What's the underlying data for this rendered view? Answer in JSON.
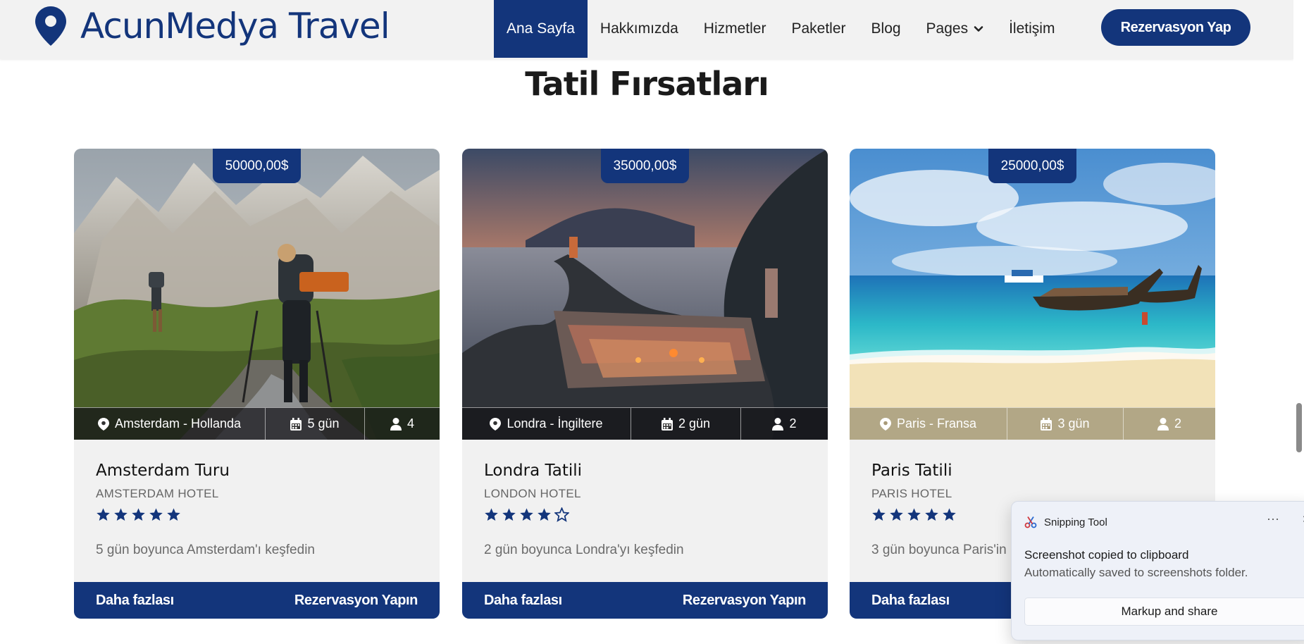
{
  "header": {
    "brand": "AcunMedya Travel",
    "nav": [
      {
        "label": "Ana Sayfa",
        "active": true
      },
      {
        "label": "Hakkımızda"
      },
      {
        "label": "Hizmetler"
      },
      {
        "label": "Paketler"
      },
      {
        "label": "Blog"
      },
      {
        "label": "Pages",
        "dropdown": true
      },
      {
        "label": "İletişim"
      }
    ],
    "cta": "Rezervasyon Yap",
    "accent_color": "#13357b"
  },
  "section": {
    "title": "Tatil Fırsatları"
  },
  "cards": [
    {
      "price": "50000,00$",
      "location": "Amsterdam - Hollanda",
      "duration": "5 gün",
      "persons": "4",
      "name": "Amsterdam Turu",
      "hotel": "AMSTERDAM HOTEL",
      "rating": 5,
      "description": "5 gün boyunca Amsterdam'ı keşfedin",
      "more_label": "Daha fazlası",
      "book_label": "Rezervasyon Yapın",
      "photo": "mountain hiking scene"
    },
    {
      "price": "35000,00$",
      "location": "Londra - İngiltere",
      "duration": "2 gün",
      "persons": "2",
      "name": "Londra Tatili",
      "hotel": "LONDON HOTEL",
      "rating": 4,
      "description": "2 gün boyunca Londra'yı keşfedin",
      "more_label": "Daha fazlası",
      "book_label": "Rezervasyon Yapın",
      "photo": "coastal village at sunset"
    },
    {
      "price": "25000,00$",
      "location": "Paris - Fransa",
      "duration": "3 gün",
      "persons": "2",
      "name": "Paris Tatili",
      "hotel": "PARIS HOTEL",
      "rating": 5,
      "description": "3 gün boyunca Paris'in",
      "more_label": "Daha fazlası",
      "book_label": "",
      "photo": "tropical beach with longtail boats"
    }
  ],
  "toast": {
    "app": "Snipping Tool",
    "more": "···",
    "title": "Screenshot copied to clipboard",
    "subtitle": "Automatically saved to screenshots folder.",
    "button": "Markup and share"
  }
}
